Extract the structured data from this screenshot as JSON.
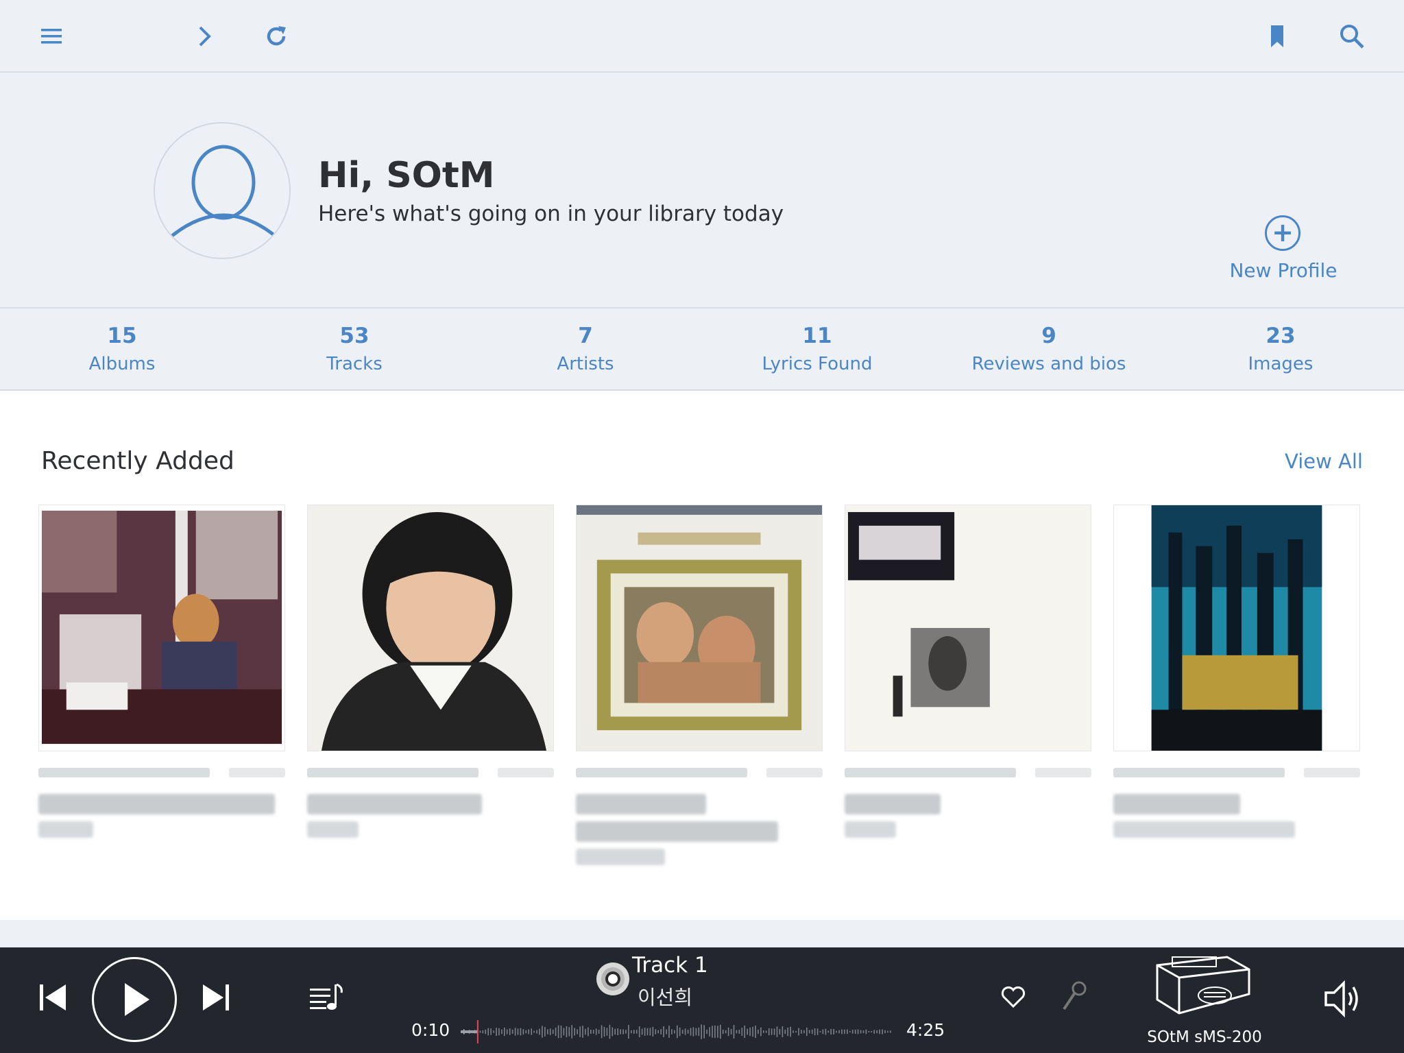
{
  "toolbar": {
    "menu_icon": "hamburger-menu-icon",
    "forward_icon": "chevron-right-icon",
    "refresh_icon": "refresh-icon",
    "bookmark_icon": "bookmark-icon",
    "search_icon": "search-icon"
  },
  "profile": {
    "greeting": "Hi, SOtM",
    "subtitle": "Here's what's going on in your library today",
    "new_profile_label": "New Profile",
    "new_profile_symbol": "+"
  },
  "stats": [
    {
      "value": "15",
      "label": "Albums"
    },
    {
      "value": "53",
      "label": "Tracks"
    },
    {
      "value": "7",
      "label": "Artists"
    },
    {
      "value": "11",
      "label": "Lyrics Found"
    },
    {
      "value": "9",
      "label": "Reviews and bios"
    },
    {
      "value": "23",
      "label": "Images"
    }
  ],
  "recent": {
    "title": "Recently Added",
    "view_all": "View All"
  },
  "player": {
    "track_title": "Track 1",
    "track_artist": "이선희",
    "elapsed": "0:10",
    "duration": "4:25",
    "progress": 0.038,
    "device_name": "SOtM sMS-200"
  },
  "colors": {
    "accent": "#4a86c6",
    "background": "#edf1f5",
    "player_bg": "#23272d",
    "progress_marker": "#e0455a"
  }
}
